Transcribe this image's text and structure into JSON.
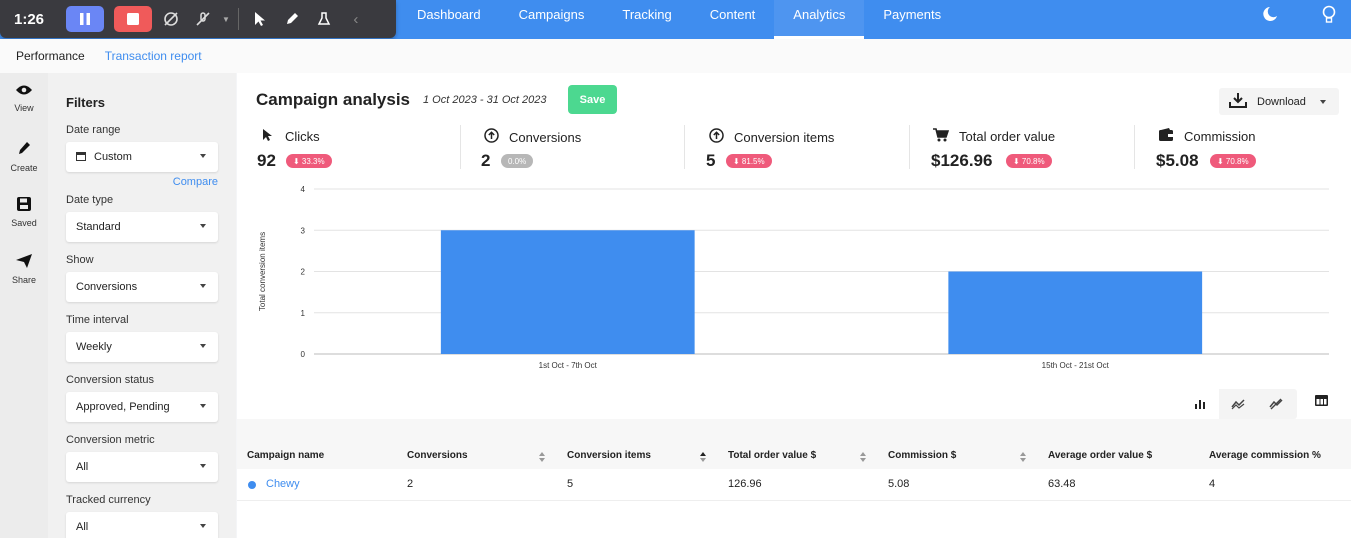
{
  "recorder": {
    "time": "1:26",
    "icons": [
      "pause-icon",
      "stop-icon",
      "webcam-off-icon",
      "mic-off-icon",
      "cursor-icon",
      "pen-icon",
      "eraser-icon",
      "collapse-icon"
    ]
  },
  "nav": {
    "tabs": [
      "Dashboard",
      "Campaigns",
      "Tracking",
      "Content",
      "Analytics",
      "Payments"
    ],
    "active": "Analytics"
  },
  "subtabs": [
    "Performance",
    "Transaction report"
  ],
  "rail": [
    {
      "label": "View",
      "icon": "eye-icon"
    },
    {
      "label": "Create",
      "icon": "pencil-icon"
    },
    {
      "label": "Saved",
      "icon": "floppy-icon"
    },
    {
      "label": "Share",
      "icon": "send-icon"
    }
  ],
  "filters": {
    "title": "Filters",
    "compare": "Compare",
    "items": [
      {
        "label": "Date range",
        "value": "Custom"
      },
      {
        "label": "Date type",
        "value": "Standard"
      },
      {
        "label": "Show",
        "value": "Conversions"
      },
      {
        "label": "Time interval",
        "value": "Weekly"
      },
      {
        "label": "Conversion status",
        "value": "Approved, Pending"
      },
      {
        "label": "Conversion metric",
        "value": "All"
      },
      {
        "label": "Tracked currency",
        "value": "All"
      }
    ]
  },
  "header": {
    "title": "Campaign analysis",
    "date_range": "1 Oct 2023 - 31 Oct 2023",
    "save": "Save",
    "download": "Download"
  },
  "kpis": [
    {
      "label": "Clicks",
      "value": "92",
      "change": "⬇ 33.3%",
      "tone": "red",
      "icon": "cursor-icon"
    },
    {
      "label": "Conversions",
      "value": "2",
      "change": "0.0%",
      "tone": "grey",
      "icon": "arrow-up-circle-icon"
    },
    {
      "label": "Conversion items",
      "value": "5",
      "change": "⬇ 81.5%",
      "tone": "red",
      "icon": "arrow-up-circle-icon"
    },
    {
      "label": "Total order value",
      "value": "$126.96",
      "change": "⬇ 70.8%",
      "tone": "red",
      "icon": "cart-icon"
    },
    {
      "label": "Commission",
      "value": "$5.08",
      "change": "⬇ 70.8%",
      "tone": "red",
      "icon": "wallet-icon"
    }
  ],
  "chart_data": {
    "type": "bar",
    "categories": [
      "1st Oct - 7th Oct",
      "15th Oct - 21st Oct"
    ],
    "values": [
      3,
      2
    ],
    "ylabel": "Total conversion items",
    "xlabel": "",
    "ylim": [
      0,
      4
    ],
    "yticks": [
      0,
      1,
      2,
      3,
      4
    ],
    "grid": true,
    "color": "#3f8def"
  },
  "table": {
    "headers": [
      "Campaign name",
      "Conversions",
      "Conversion items",
      "Total order value $",
      "Commission $",
      "Average order value $",
      "Average commission %"
    ],
    "rows": [
      [
        "Chewy",
        "2",
        "5",
        "126.96",
        "5.08",
        "63.48",
        "4"
      ]
    ]
  },
  "colors": {
    "nav": "#3f8def",
    "save": "#4cd890",
    "badge_red": "#ef5a7b",
    "bar": "#3f8def"
  }
}
